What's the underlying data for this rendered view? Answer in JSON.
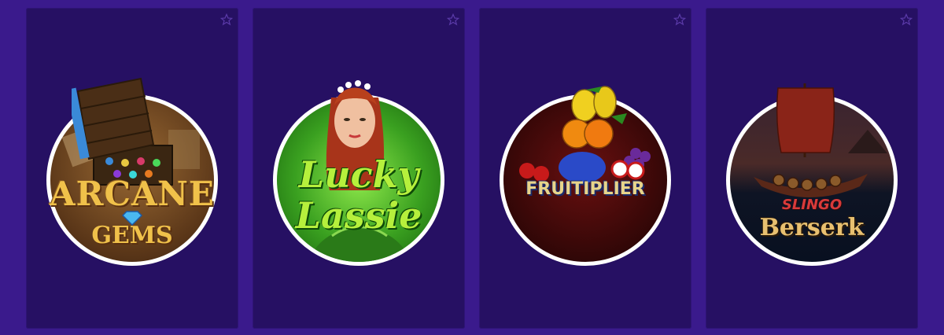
{
  "games": [
    {
      "title_line1": "ARCANE",
      "title_line2": "GEMS",
      "favorite_icon": "star-outline-icon",
      "colors": {
        "bg1": "#4a2c14",
        "bg2": "#8a5a2a",
        "text": "#f0c14a",
        "accent": "#3a8ad8"
      }
    },
    {
      "title_line1": "Lucky",
      "title_line2": "Lassie",
      "favorite_icon": "star-outline-icon",
      "colors": {
        "bg1": "#1c6a16",
        "bg2": "#7ed83c",
        "text": "#b6f03c",
        "accent": "#b8401c"
      }
    },
    {
      "title_line1": "FRUITIPLIER",
      "title_line2": "",
      "favorite_icon": "star-outline-icon",
      "colors": {
        "bg1": "#2a0808",
        "bg2": "#6a1010",
        "text": "#e8d48a",
        "accent": "#f0a01c"
      }
    },
    {
      "title_line1": "SLINGO",
      "title_line2": "Berserk",
      "favorite_icon": "star-outline-icon",
      "colors": {
        "bg1": "#0c1020",
        "bg2": "#3a2a30",
        "text": "#e8c070",
        "accent": "#8a2418"
      }
    }
  ]
}
